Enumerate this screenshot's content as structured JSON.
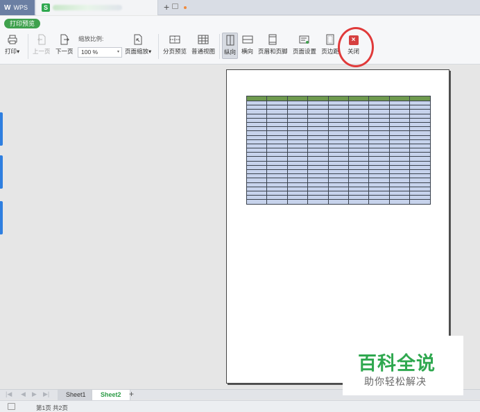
{
  "titlebar": {
    "app_tab": "WPS",
    "app_logo": "W",
    "doc_icon_letter": "S",
    "new_tab": "+"
  },
  "toolbar": {
    "mode_badge": "打印预览",
    "print_label": "打印",
    "prev_page_label": "上一页",
    "next_page_label": "下一页",
    "zoom_ratio_label": "缩放比例:",
    "zoom_value": "100 %",
    "page_scale_label": "页面缩放",
    "page_break_preview_label": "分页预览",
    "normal_view_label": "普通视图",
    "portrait_label": "纵向",
    "landscape_label": "横向",
    "header_footer_label": "页眉和页脚",
    "page_setup_label": "页面设置",
    "margins_label": "页边距",
    "close_label": "关闭",
    "close_icon_glyph": "×",
    "dropdown_glyph": "▾"
  },
  "sheets": {
    "tabs": [
      "Sheet1",
      "Sheet2"
    ],
    "active": "Sheet2",
    "add": "+"
  },
  "status": {
    "page_info": "第1页 共2页"
  },
  "preview_table": {
    "columns": 9,
    "header_rows": 1,
    "body_rows": 24,
    "header_color": "#6e9a4e",
    "cell_color": "#c7d3ec"
  },
  "watermark": {
    "title": "百科全说",
    "subtitle": "助你轻松解决"
  },
  "colors": {
    "accent_green": "#3fa14d",
    "close_red": "#d64040",
    "highlight_circle": "#e03a3a",
    "left_bars": "#2f7fe0"
  }
}
